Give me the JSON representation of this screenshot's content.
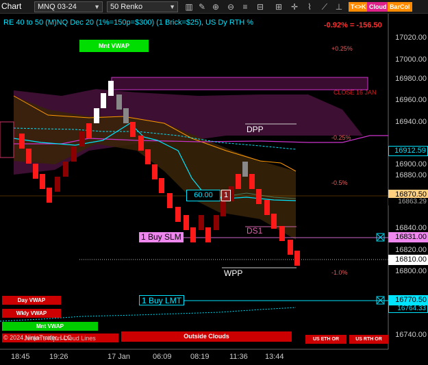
{
  "toolbar": {
    "title": "Chart",
    "instrument": "MNQ 03-24",
    "bar_type": "50 Renko",
    "pills": {
      "tk": "T<>K",
      "cloud": "Cloud",
      "barcol": "BarCol"
    }
  },
  "header": {
    "indicator_text": "RE 40 to 50 (M)NQ Dec 20 (1%=150p=$300) (1 Brick=$25), US Dy RTH %",
    "pnl_text": "-0.92% = -156.50"
  },
  "labels": {
    "mnt_vwap_top": "Mnt VWAP",
    "close_jan": "CLOSE 16 JAN",
    "dpp": "DPP",
    "ds1": "DS1",
    "wpp": "WPP",
    "box_value": "60.00",
    "box_qty": "1",
    "buy_slm": "1 Buy SLM",
    "buy_lmt": "1 Buy LMT",
    "day_vwap": "Day VWAP",
    "wkly_vwap": "Wkly VWAP",
    "mnt_vwap_bottom": "Mnt VWAP",
    "copyright": "© 2024 NinjaTrader, LLC",
    "jenkin_label": "Jenkin's Kijun Cloud Lines",
    "outside_clouds": "Outside Clouds",
    "us_eth_or": "US ETH OR",
    "us_rth_or": "US RTH OR"
  },
  "pct_levels": [
    "+0.25%",
    "-0.25%",
    "-0.5%",
    "-1.0%"
  ],
  "price_ticks": [
    "17020.00",
    "17000.00",
    "16980.00",
    "16960.00",
    "16940.00",
    "16900.00",
    "16880.00",
    "16840.00",
    "16820.00",
    "16800.00",
    "16740.00"
  ],
  "price_flags": {
    "cloud_top": "16912.59",
    "orange": "16870.50",
    "green_gray": "16863.29",
    "buy_slm": "16831.00",
    "last": "16810.00",
    "buy_lmt": "16770.50",
    "wkly": "16764.33"
  },
  "time_ticks": [
    "18:45",
    "19:26",
    "17 Jan",
    "06:09",
    "08:19",
    "11:36",
    "13:44"
  ],
  "colors": {
    "up_brick": "#ffffff",
    "down_brick": "#ff1a1a",
    "dark_brick": "#8b0000",
    "cyan": "#00e5ff",
    "orange": "#ff9900",
    "magenta": "#cc33cc",
    "green": "#00dd00"
  }
}
